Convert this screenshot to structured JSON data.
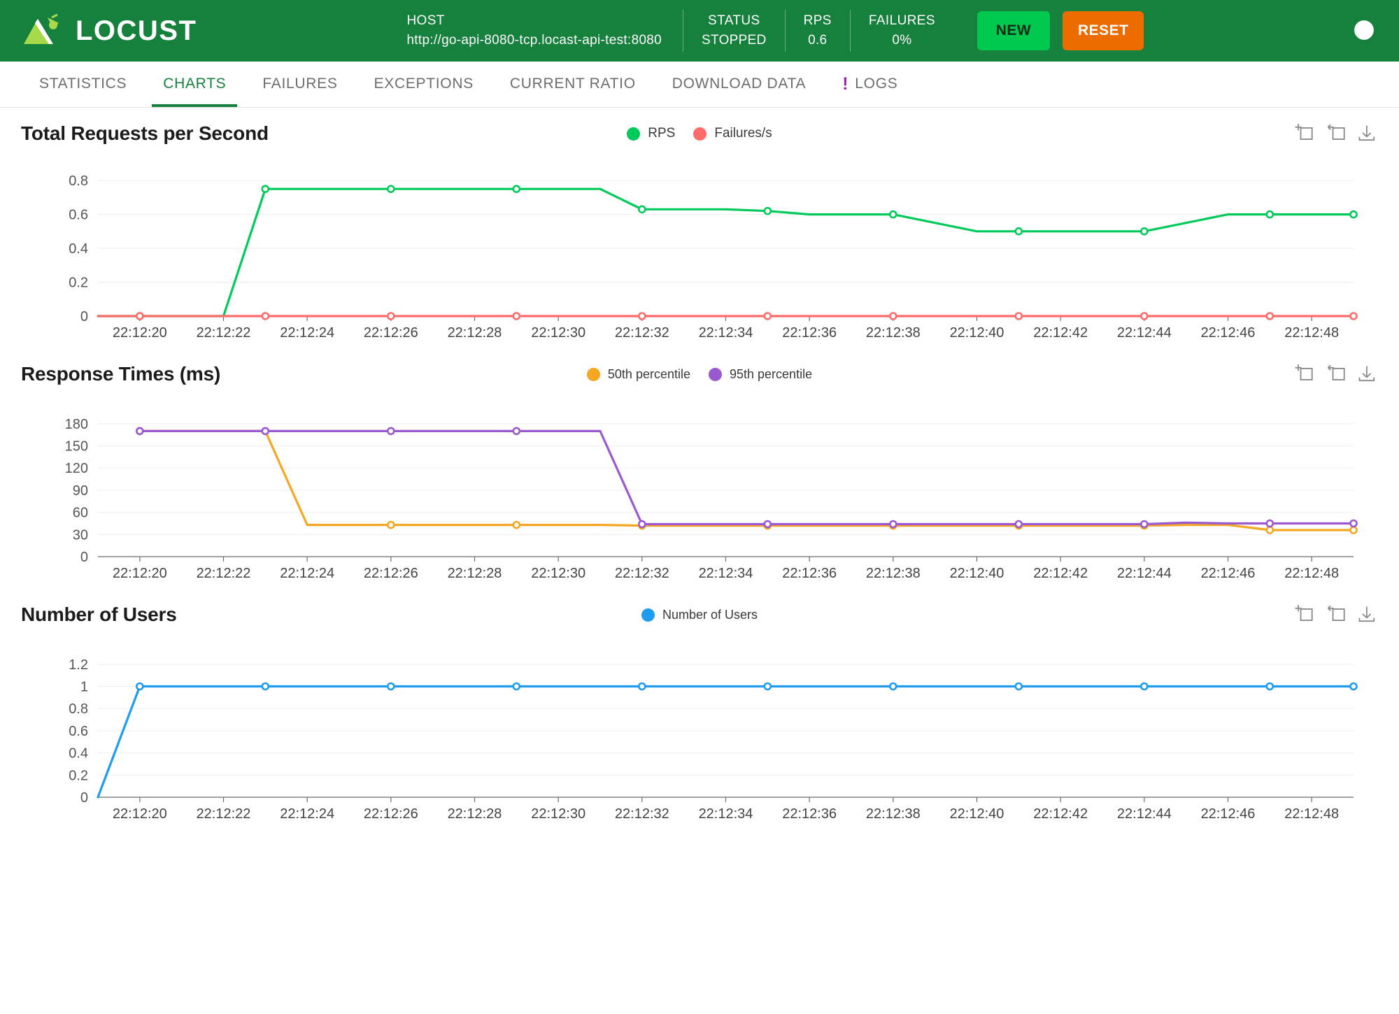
{
  "header": {
    "brand": "LOCUST",
    "logo_icon": "locust-logo",
    "host_label": "HOST",
    "host_value": "http://go-api-8080-tcp.locast-api-test:8080",
    "status_label": "STATUS",
    "status_value": "STOPPED",
    "rps_label": "RPS",
    "rps_value": "0.6",
    "failures_label": "FAILURES",
    "failures_value": "0%",
    "new_button": "NEW",
    "reset_button": "RESET",
    "theme_icon": "dark-mode-icon",
    "colors": {
      "header_bg": "#16813d",
      "new_button": "#00c950",
      "reset_button": "#ed6c02"
    }
  },
  "tabs": [
    {
      "label": "STATISTICS",
      "active": false
    },
    {
      "label": "CHARTS",
      "active": true
    },
    {
      "label": "FAILURES",
      "active": false
    },
    {
      "label": "EXCEPTIONS",
      "active": false
    },
    {
      "label": "CURRENT RATIO",
      "active": false
    },
    {
      "label": "DOWNLOAD DATA",
      "active": false
    },
    {
      "label": "LOGS",
      "active": false,
      "icon": "exclamation-icon"
    }
  ],
  "chart_tools": {
    "zoom_icon": "zoom-area-icon",
    "restore_icon": "restore-icon",
    "download_icon": "download-icon"
  },
  "chart_data": [
    {
      "type": "line",
      "title": "Total Requests per Second",
      "xlabel": "",
      "ylabel": "",
      "grid": true,
      "legend_position": "top-center",
      "x": [
        "22:12:19",
        "22:12:20",
        "22:12:21",
        "22:12:22",
        "22:12:23",
        "22:12:24",
        "22:12:25",
        "22:12:26",
        "22:12:27",
        "22:12:28",
        "22:12:29",
        "22:12:30",
        "22:12:31",
        "22:12:32",
        "22:12:33",
        "22:12:34",
        "22:12:35",
        "22:12:36",
        "22:12:37",
        "22:12:38",
        "22:12:39",
        "22:12:40",
        "22:12:41",
        "22:12:42",
        "22:12:43",
        "22:12:44",
        "22:12:45",
        "22:12:46",
        "22:12:47",
        "22:12:48",
        "22:12:49"
      ],
      "tick_labels": [
        "22:12:20",
        "22:12:22",
        "22:12:24",
        "22:12:26",
        "22:12:28",
        "22:12:30",
        "22:12:32",
        "22:12:34",
        "22:12:36",
        "22:12:38",
        "22:12:40",
        "22:12:42",
        "22:12:44",
        "22:12:46",
        "22:12:48"
      ],
      "yticks": [
        0,
        0.2,
        0.4,
        0.6,
        0.8
      ],
      "ylim": [
        0,
        0.85
      ],
      "series": [
        {
          "name": "RPS",
          "color": "#00ca5a",
          "markers": [
            1,
            4,
            7,
            10,
            13,
            16,
            19,
            22,
            25,
            28,
            30
          ],
          "values": [
            0,
            0,
            0,
            0,
            0.75,
            0.75,
            0.75,
            0.75,
            0.75,
            0.75,
            0.75,
            0.75,
            0.75,
            0.63,
            0.63,
            0.63,
            0.62,
            0.6,
            0.6,
            0.6,
            0.55,
            0.5,
            0.5,
            0.5,
            0.5,
            0.5,
            0.55,
            0.6,
            0.6,
            0.6,
            0.6
          ]
        },
        {
          "name": "Failures/s",
          "color": "#ff6b6b",
          "markers": [
            1,
            4,
            7,
            10,
            13,
            16,
            19,
            22,
            25,
            28,
            30
          ],
          "values": [
            0,
            0,
            0,
            0,
            0,
            0,
            0,
            0,
            0,
            0,
            0,
            0,
            0,
            0,
            0,
            0,
            0,
            0,
            0,
            0,
            0,
            0,
            0,
            0,
            0,
            0,
            0,
            0,
            0,
            0,
            0
          ]
        }
      ]
    },
    {
      "type": "line",
      "title": "Response Times (ms)",
      "xlabel": "",
      "ylabel": "",
      "grid": true,
      "legend_position": "top-center",
      "x": [
        "22:12:19",
        "22:12:20",
        "22:12:21",
        "22:12:22",
        "22:12:23",
        "22:12:24",
        "22:12:25",
        "22:12:26",
        "22:12:27",
        "22:12:28",
        "22:12:29",
        "22:12:30",
        "22:12:31",
        "22:12:32",
        "22:12:33",
        "22:12:34",
        "22:12:35",
        "22:12:36",
        "22:12:37",
        "22:12:38",
        "22:12:39",
        "22:12:40",
        "22:12:41",
        "22:12:42",
        "22:12:43",
        "22:12:44",
        "22:12:45",
        "22:12:46",
        "22:12:47",
        "22:12:48",
        "22:12:49"
      ],
      "tick_labels": [
        "22:12:20",
        "22:12:22",
        "22:12:24",
        "22:12:26",
        "22:12:28",
        "22:12:30",
        "22:12:32",
        "22:12:34",
        "22:12:36",
        "22:12:38",
        "22:12:40",
        "22:12:42",
        "22:12:44",
        "22:12:46",
        "22:12:48"
      ],
      "yticks": [
        0,
        30,
        60,
        90,
        120,
        150,
        180
      ],
      "ylim": [
        0,
        195
      ],
      "x_start_index": 1,
      "series": [
        {
          "name": "50th percentile",
          "color": "#f5a623",
          "markers": [
            1,
            4,
            7,
            10,
            13,
            16,
            19,
            22,
            25,
            28,
            30
          ],
          "values": [
            null,
            170,
            170,
            170,
            170,
            43,
            43,
            43,
            43,
            43,
            43,
            43,
            43,
            42,
            42,
            42,
            42,
            42,
            42,
            42,
            42,
            42,
            42,
            42,
            42,
            42,
            43,
            43,
            36,
            36,
            36
          ]
        },
        {
          "name": "95th percentile",
          "color": "#9b59d0",
          "markers": [
            1,
            4,
            7,
            10,
            13,
            16,
            19,
            22,
            25,
            28,
            30
          ],
          "values": [
            null,
            170,
            170,
            170,
            170,
            170,
            170,
            170,
            170,
            170,
            170,
            170,
            170,
            44,
            44,
            44,
            44,
            44,
            44,
            44,
            44,
            44,
            44,
            44,
            44,
            44,
            46,
            45,
            45,
            45,
            45
          ]
        }
      ]
    },
    {
      "type": "line",
      "title": "Number of Users",
      "xlabel": "",
      "ylabel": "",
      "grid": true,
      "legend_position": "top-center",
      "x": [
        "22:12:19",
        "22:12:20",
        "22:12:21",
        "22:12:22",
        "22:12:23",
        "22:12:24",
        "22:12:25",
        "22:12:26",
        "22:12:27",
        "22:12:28",
        "22:12:29",
        "22:12:30",
        "22:12:31",
        "22:12:32",
        "22:12:33",
        "22:12:34",
        "22:12:35",
        "22:12:36",
        "22:12:37",
        "22:12:38",
        "22:12:39",
        "22:12:40",
        "22:12:41",
        "22:12:42",
        "22:12:43",
        "22:12:44",
        "22:12:45",
        "22:12:46",
        "22:12:47",
        "22:12:48",
        "22:12:49"
      ],
      "tick_labels": [
        "22:12:20",
        "22:12:22",
        "22:12:24",
        "22:12:26",
        "22:12:28",
        "22:12:30",
        "22:12:32",
        "22:12:34",
        "22:12:36",
        "22:12:38",
        "22:12:40",
        "22:12:42",
        "22:12:44",
        "22:12:46",
        "22:12:48"
      ],
      "yticks": [
        0,
        0.2,
        0.4,
        0.6,
        0.8,
        1,
        1.2
      ],
      "ylim": [
        0,
        1.3
      ],
      "series": [
        {
          "name": "Number of Users",
          "color": "#1f9bf0",
          "markers": [
            1,
            4,
            7,
            10,
            13,
            16,
            19,
            22,
            25,
            28,
            30
          ],
          "values": [
            0,
            1,
            1,
            1,
            1,
            1,
            1,
            1,
            1,
            1,
            1,
            1,
            1,
            1,
            1,
            1,
            1,
            1,
            1,
            1,
            1,
            1,
            1,
            1,
            1,
            1,
            1,
            1,
            1,
            1,
            1
          ]
        }
      ]
    }
  ]
}
